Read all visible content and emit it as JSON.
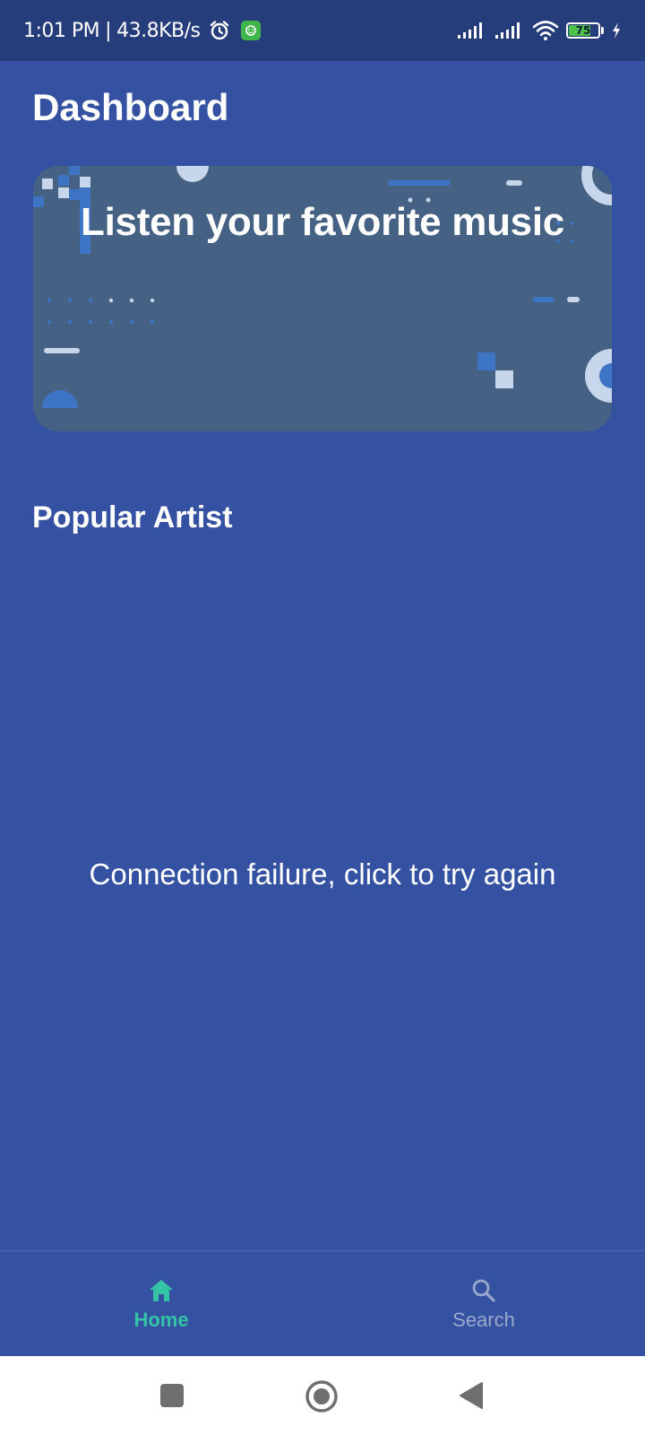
{
  "status_bar": {
    "time": "1:01 PM",
    "separator": "|",
    "network_speed": "43.8KB/s",
    "battery_level": "75",
    "battery_fraction": 0.75,
    "icons": [
      "alarm-icon",
      "app-notification-icon",
      "signal-icon",
      "signal-icon",
      "wifi-icon",
      "battery-icon",
      "charging-icon"
    ]
  },
  "header": {
    "title": "Dashboard"
  },
  "banner": {
    "title": "Listen your favorite music"
  },
  "popular_artist": {
    "title": "Popular Artist"
  },
  "error": {
    "message": "Connection failure, click to try again"
  },
  "bottom_nav": {
    "items": [
      {
        "label": "Home",
        "icon": "home-icon",
        "active": true
      },
      {
        "label": "Search",
        "icon": "search-icon",
        "active": false
      }
    ]
  },
  "system_nav": {
    "icons": [
      "recents-icon",
      "home-circle-icon",
      "back-icon"
    ]
  },
  "colors": {
    "background": "#3552a2",
    "status_bar": "#263d7c",
    "banner": "#456284",
    "active_tab": "#34c3a4",
    "inactive_tab": "#9aa8c9",
    "battery_fill": "#4cc24a"
  }
}
